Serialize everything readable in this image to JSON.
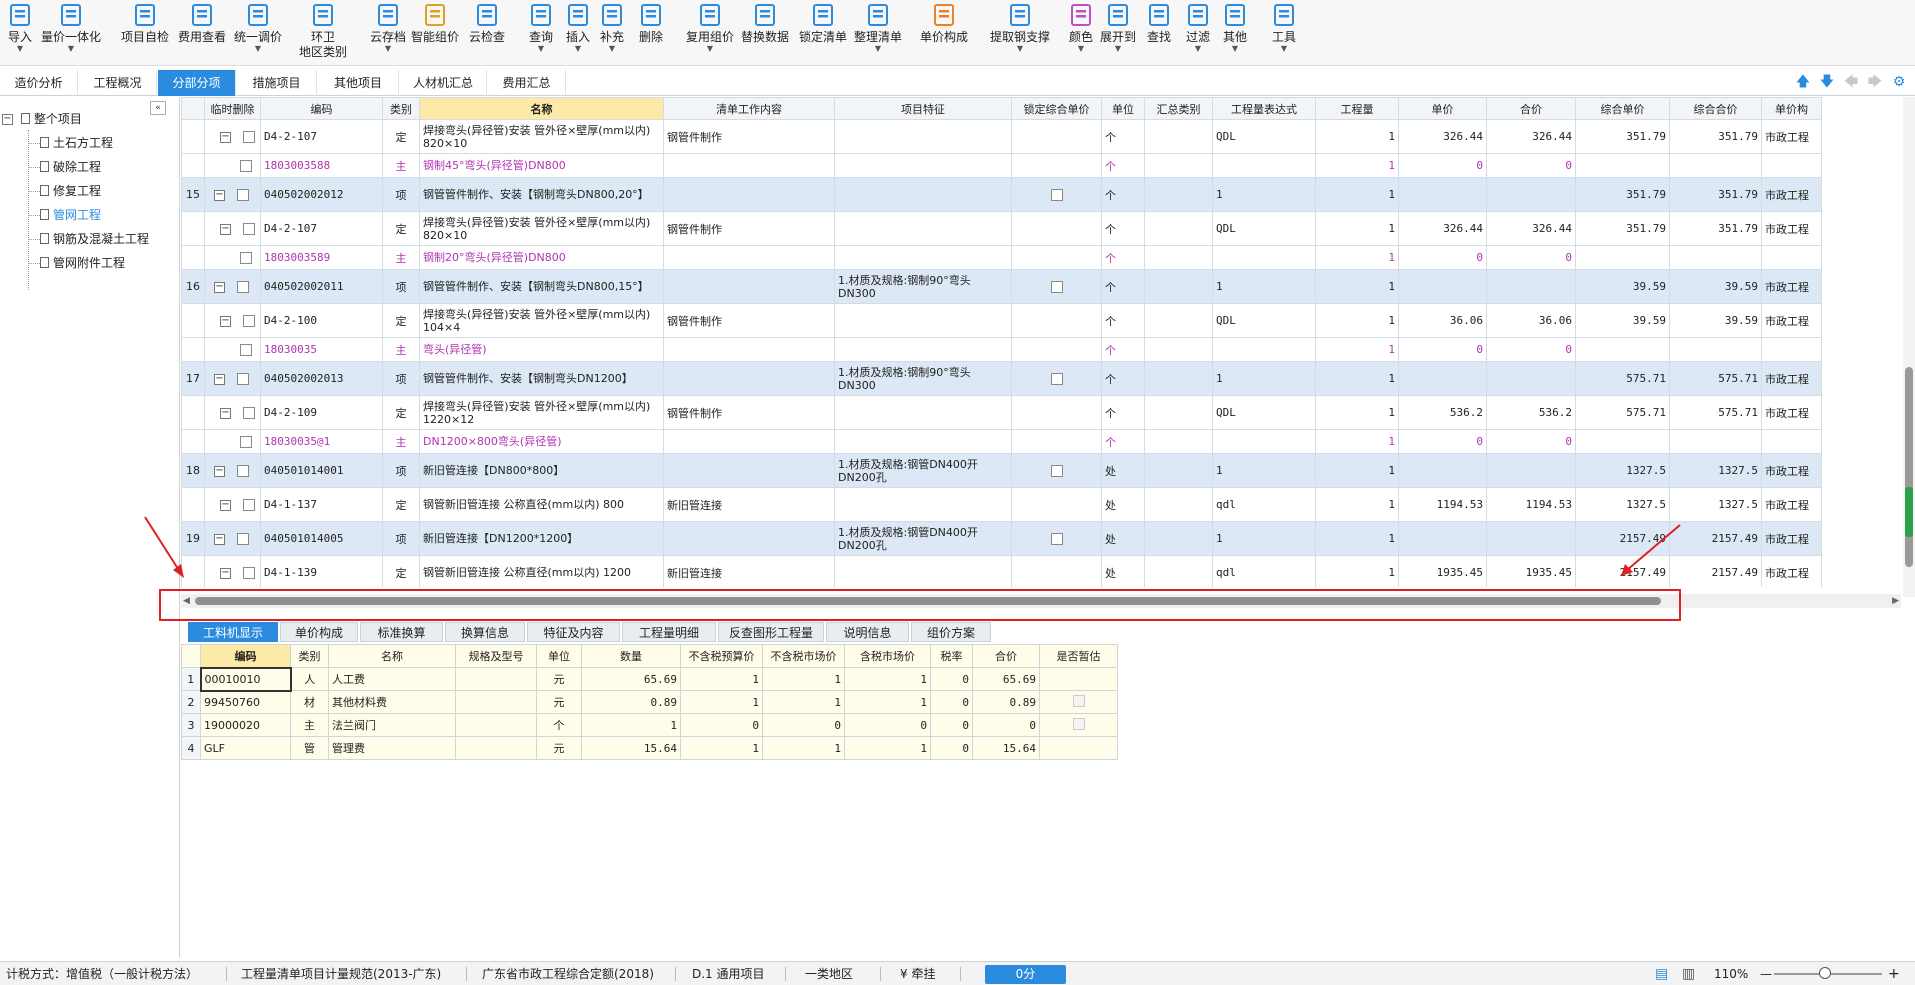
{
  "toolbar": [
    {
      "name": "import-button",
      "label": "导入",
      "caret": true,
      "icon": "import-icon"
    },
    {
      "name": "quantity-price-button",
      "label": "量价一体化",
      "caret": true,
      "icon": "quantity-price-icon"
    },
    {
      "name": "self-check-button",
      "label": "项目自检",
      "caret": false,
      "icon": "self-check-icon"
    },
    {
      "name": "fee-view-button",
      "label": "费用查看",
      "caret": false,
      "icon": "fee-view-icon"
    },
    {
      "name": "unified-price-button",
      "label": "统一调价",
      "caret": true,
      "icon": "price-adjust-icon"
    },
    {
      "name": "env-region-button",
      "label": "环卫\n地区类别",
      "caret": false,
      "icon": "region-icon"
    },
    {
      "name": "cloud-save-button",
      "label": "云存档",
      "caret": true,
      "icon": "cloud-save-icon"
    },
    {
      "name": "smart-price-button",
      "label": "智能组价",
      "caret": false,
      "icon": "smart-price-icon"
    },
    {
      "name": "cloud-check-button",
      "label": "云检查",
      "caret": false,
      "icon": "cloud-check-icon"
    },
    {
      "name": "query-button",
      "label": "查询",
      "caret": true,
      "icon": "query-icon"
    },
    {
      "name": "insert-button",
      "label": "插入",
      "caret": true,
      "icon": "insert-icon"
    },
    {
      "name": "supplement-button",
      "label": "补充",
      "caret": true,
      "icon": "supplement-icon"
    },
    {
      "name": "delete-button",
      "label": "删除",
      "caret": false,
      "icon": "trash-icon"
    },
    {
      "name": "reuse-price-button",
      "label": "复用组价",
      "caret": true,
      "icon": "reuse-icon"
    },
    {
      "name": "replace-data-button",
      "label": "替换数据",
      "caret": false,
      "icon": "replace-icon"
    },
    {
      "name": "lock-list-button",
      "label": "锁定清单",
      "caret": false,
      "icon": "lock-icon"
    },
    {
      "name": "organize-list-button",
      "label": "整理清单",
      "caret": true,
      "icon": "organize-icon"
    },
    {
      "name": "unit-price-composition-button",
      "label": "单价构成",
      "caret": false,
      "icon": "unit-price-icon"
    },
    {
      "name": "extract-steel-button",
      "label": "提取钢支撑",
      "caret": true,
      "icon": "extract-icon"
    },
    {
      "name": "color-button",
      "label": "颜色",
      "caret": true,
      "icon": "color-icon"
    },
    {
      "name": "expand-to-button",
      "label": "展开到",
      "caret": true,
      "icon": "expand-icon"
    },
    {
      "name": "find-button",
      "label": "查找",
      "caret": false,
      "icon": "binoculars-icon"
    },
    {
      "name": "filter-button",
      "label": "过滤",
      "caret": true,
      "icon": "filter-icon"
    },
    {
      "name": "other-button",
      "label": "其他",
      "caret": true,
      "icon": "grid-icon"
    },
    {
      "name": "tools-button",
      "label": "工具",
      "caret": true,
      "icon": "tools-icon"
    }
  ],
  "tabs": [
    {
      "label": "造价分析",
      "active": false
    },
    {
      "label": "工程概况",
      "active": false
    },
    {
      "label": "分部分项",
      "active": true
    },
    {
      "label": "措施项目",
      "active": false
    },
    {
      "label": "其他项目",
      "active": false
    },
    {
      "label": "人材机汇总",
      "active": false
    },
    {
      "label": "费用汇总",
      "active": false
    }
  ],
  "tree": {
    "root": "整个项目",
    "items": [
      {
        "label": "土石方工程",
        "active": false
      },
      {
        "label": "破除工程",
        "active": false
      },
      {
        "label": "修复工程",
        "active": false
      },
      {
        "label": "管网工程",
        "active": true
      },
      {
        "label": "钢筋及混凝土工程",
        "active": false
      },
      {
        "label": "管网附件工程",
        "active": false
      }
    ]
  },
  "grid": {
    "headers": [
      "",
      "临时删除",
      "编码",
      "类别",
      "名称",
      "清单工作内容",
      "项目特征",
      "锁定综合单价",
      "单位",
      "汇总类别",
      "工程量表达式",
      "工程量",
      "单价",
      "合价",
      "综合单价",
      "综合合价",
      "单价构"
    ],
    "rows": [
      {
        "kind": "def",
        "no": "",
        "code": "D4-2-107",
        "type": "定",
        "name": "焊接弯头(异径管)安装 管外径×壁厚(mm以内) 820×10",
        "work": "钢管件制作",
        "feature": "",
        "unit": "个",
        "expr": "QDL",
        "qty": "1",
        "price": "326.44",
        "total": "326.44",
        "cprice": "351.79",
        "ctotal": "351.79",
        "cat": "市政工程"
      },
      {
        "kind": "main",
        "no": "",
        "code": "1803003588",
        "type": "主",
        "name": "钢制45°弯头(异径管)DN800",
        "work": "",
        "feature": "",
        "unit": "个",
        "expr": "",
        "qty": "1",
        "price": "0",
        "total": "0",
        "cprice": "",
        "ctotal": "",
        "cat": ""
      },
      {
        "kind": "proj",
        "no": "15",
        "code": "040502002012",
        "type": "项",
        "name": "钢管管件制作、安装【钢制弯头DN800,20°】",
        "work": "",
        "feature": "",
        "unit": "个",
        "expr": "1",
        "qty": "1",
        "price": "",
        "total": "",
        "cprice": "351.79",
        "ctotal": "351.79",
        "cat": "市政工程"
      },
      {
        "kind": "def",
        "no": "",
        "code": "D4-2-107",
        "type": "定",
        "name": "焊接弯头(异径管)安装 管外径×壁厚(mm以内) 820×10",
        "work": "钢管件制作",
        "feature": "",
        "unit": "个",
        "expr": "QDL",
        "qty": "1",
        "price": "326.44",
        "total": "326.44",
        "cprice": "351.79",
        "ctotal": "351.79",
        "cat": "市政工程"
      },
      {
        "kind": "main",
        "no": "",
        "code": "1803003589",
        "type": "主",
        "name": "钢制20°弯头(异径管)DN800",
        "work": "",
        "feature": "",
        "unit": "个",
        "expr": "",
        "qty": "1",
        "price": "0",
        "total": "0",
        "cprice": "",
        "ctotal": "",
        "cat": ""
      },
      {
        "kind": "proj",
        "no": "16",
        "code": "040502002011",
        "type": "项",
        "name": "钢管管件制作、安装【钢制弯头DN800,15°】",
        "work": "",
        "feature": "1.材质及规格:钢制90°弯头DN300",
        "unit": "个",
        "expr": "1",
        "qty": "1",
        "price": "",
        "total": "",
        "cprice": "39.59",
        "ctotal": "39.59",
        "cat": "市政工程"
      },
      {
        "kind": "def",
        "no": "",
        "code": "D4-2-100",
        "type": "定",
        "name": "焊接弯头(异径管)安装 管外径×壁厚(mm以内) 104×4",
        "work": "钢管件制作",
        "feature": "",
        "unit": "个",
        "expr": "QDL",
        "qty": "1",
        "price": "36.06",
        "total": "36.06",
        "cprice": "39.59",
        "ctotal": "39.59",
        "cat": "市政工程"
      },
      {
        "kind": "main",
        "no": "",
        "code": "18030035",
        "type": "主",
        "name": "弯头(异径管)",
        "work": "",
        "feature": "",
        "unit": "个",
        "expr": "",
        "qty": "1",
        "price": "0",
        "total": "0",
        "cprice": "",
        "ctotal": "",
        "cat": ""
      },
      {
        "kind": "proj",
        "no": "17",
        "code": "040502002013",
        "type": "项",
        "name": "钢管管件制作、安装【钢制弯头DN1200】",
        "work": "",
        "feature": "1.材质及规格:钢制90°弯头DN300",
        "unit": "个",
        "expr": "1",
        "qty": "1",
        "price": "",
        "total": "",
        "cprice": "575.71",
        "ctotal": "575.71",
        "cat": "市政工程"
      },
      {
        "kind": "def",
        "no": "",
        "code": "D4-2-109",
        "type": "定",
        "name": "焊接弯头(异径管)安装 管外径×壁厚(mm以内) 1220×12",
        "work": "钢管件制作",
        "feature": "",
        "unit": "个",
        "expr": "QDL",
        "qty": "1",
        "price": "536.2",
        "total": "536.2",
        "cprice": "575.71",
        "ctotal": "575.71",
        "cat": "市政工程"
      },
      {
        "kind": "main",
        "no": "",
        "code": "18030035@1",
        "type": "主",
        "name": "DN1200×800弯头(异径管)",
        "work": "",
        "feature": "",
        "unit": "个",
        "expr": "",
        "qty": "1",
        "price": "0",
        "total": "0",
        "cprice": "",
        "ctotal": "",
        "cat": ""
      },
      {
        "kind": "proj",
        "no": "18",
        "code": "040501014001",
        "type": "项",
        "name": "新旧管连接【DN800*800】",
        "work": "",
        "feature": "1.材质及规格:钢管DN400开DN200孔",
        "unit": "处",
        "expr": "1",
        "qty": "1",
        "price": "",
        "total": "",
        "cprice": "1327.5",
        "ctotal": "1327.5",
        "cat": "市政工程"
      },
      {
        "kind": "def",
        "no": "",
        "code": "D4-1-137",
        "type": "定",
        "name": "钢管新旧管连接 公称直径(mm以内) 800",
        "work": "新旧管连接",
        "feature": "",
        "unit": "处",
        "expr": "qdl",
        "qty": "1",
        "price": "1194.53",
        "total": "1194.53",
        "cprice": "1327.5",
        "ctotal": "1327.5",
        "cat": "市政工程"
      },
      {
        "kind": "proj",
        "no": "19",
        "code": "040501014005",
        "type": "项",
        "name": "新旧管连接【DN1200*1200】",
        "work": "",
        "feature": "1.材质及规格:钢管DN400开DN200孔",
        "unit": "处",
        "expr": "1",
        "qty": "1",
        "price": "",
        "total": "",
        "cprice": "2157.49",
        "ctotal": "2157.49",
        "cat": "市政工程"
      },
      {
        "kind": "def",
        "no": "",
        "code": "D4-1-139",
        "type": "定",
        "name": "钢管新旧管连接 公称直径(mm以内) 1200",
        "work": "新旧管连接",
        "feature": "",
        "unit": "处",
        "expr": "qdl",
        "qty": "1",
        "price": "1935.45",
        "total": "1935.45",
        "cprice": "2157.49",
        "ctotal": "2157.49",
        "cat": "市政工程"
      }
    ]
  },
  "bottom_tabs": [
    {
      "label": "工料机显示",
      "active": true
    },
    {
      "label": "单价构成",
      "active": false
    },
    {
      "label": "标准换算",
      "active": false
    },
    {
      "label": "换算信息",
      "active": false
    },
    {
      "label": "特征及内容",
      "active": false
    },
    {
      "label": "工程量明细",
      "active": false
    },
    {
      "label": "反查图形工程量",
      "active": false
    },
    {
      "label": "说明信息",
      "active": false
    },
    {
      "label": "组价方案",
      "active": false
    }
  ],
  "subgrid": {
    "headers": [
      "",
      "编码",
      "类别",
      "名称",
      "规格及型号",
      "单位",
      "数量",
      "不含税预算价",
      "不含税市场价",
      "含税市场价",
      "税率",
      "合价",
      "是否暂估"
    ],
    "rows": [
      {
        "n": "1",
        "code": "00010010",
        "type": "人",
        "name": "人工费",
        "spec": "",
        "unit": "元",
        "qty": "65.69",
        "p1": "1",
        "p2": "1",
        "p3": "1",
        "tax": "0",
        "total": "65.69",
        "est": false
      },
      {
        "n": "2",
        "code": "99450760",
        "type": "材",
        "name": "其他材料费",
        "spec": "",
        "unit": "元",
        "qty": "0.89",
        "p1": "1",
        "p2": "1",
        "p3": "1",
        "tax": "0",
        "total": "0.89",
        "est": true
      },
      {
        "n": "3",
        "code": "19000020",
        "type": "主",
        "name": "法兰阀门",
        "spec": "",
        "unit": "个",
        "qty": "1",
        "p1": "0",
        "p2": "0",
        "p3": "0",
        "tax": "0",
        "total": "0",
        "est": true
      },
      {
        "n": "4",
        "code": "GLF",
        "type": "管",
        "name": "管理费",
        "spec": "",
        "unit": "元",
        "qty": "15.64",
        "p1": "1",
        "p2": "1",
        "p3": "1",
        "tax": "0",
        "total": "15.64",
        "est": false
      }
    ]
  },
  "status": {
    "tax_mode": "计税方式：增值税（一般计税方法）",
    "spec": "工程量清单项目计量规范(2013-广东)",
    "quota": "广东省市政工程综合定额(2018)",
    "item": "D.1 通用项目",
    "region": "一类地区",
    "tag": "¥ 牵挂",
    "score": "0分",
    "zoom": "110%",
    "zoom_minus": "—",
    "zoom_plus": "+"
  },
  "colors": {
    "accent": "#2b8cdf",
    "annotation": "#e02020",
    "main_material": "#b035b0",
    "project_row": "#dce8f6"
  }
}
